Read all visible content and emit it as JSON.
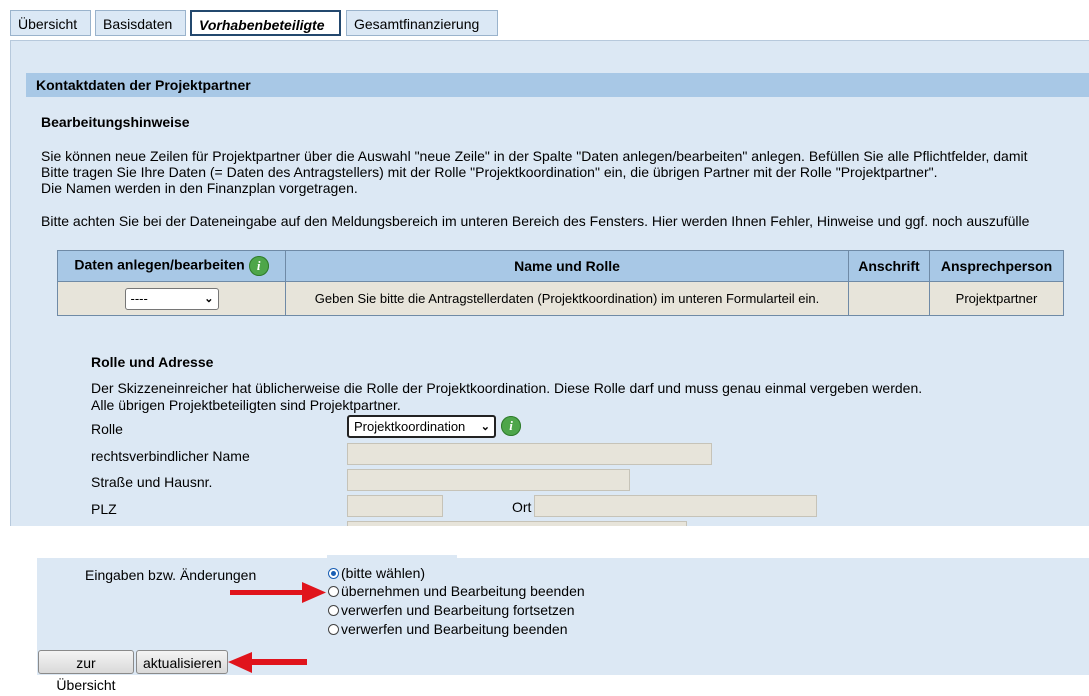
{
  "tabs": [
    {
      "label": "Übersicht",
      "active": false
    },
    {
      "label": "Basisdaten",
      "active": false
    },
    {
      "label": "Vorhabenbeteiligte",
      "active": true
    },
    {
      "label": "Gesamtfinanzierung",
      "active": false
    }
  ],
  "section": {
    "title": "Kontaktdaten der Projektpartner",
    "hints_heading": "Bearbeitungshinweise",
    "hint_lines": [
      "Sie können neue Zeilen für Projektpartner über die Auswahl \"neue Zeile\" in der Spalte \"Daten anlegen/bearbeiten\" anlegen. Befüllen Sie alle Pflichtfelder, damit",
      "Bitte tragen Sie Ihre Daten (= Daten des Antragstellers) mit der Rolle \"Projektkoordination\" ein, die übrigen Partner mit der Rolle \"Projektpartner\".",
      "Die Namen werden in den Finanzplan vorgetragen."
    ],
    "notice_line": "Bitte achten Sie bei der Dateneingabe auf den Meldungsbereich im unteren Bereich des Fensters. Hier werden Ihnen Fehler, Hinweise und ggf. noch auszufülle"
  },
  "table": {
    "headers": [
      "Daten anlegen/bearbeiten",
      "Name und Rolle",
      "Anschrift",
      "Ansprechperson"
    ],
    "row": {
      "action_select": "----",
      "name_role": "Geben Sie bitte die Antragstellerdaten (Projektkoordination) im unteren Formularteil ein.",
      "address": "",
      "contact": "Projektpartner"
    }
  },
  "form": {
    "heading": "Rolle und Adresse",
    "desc_lines": [
      "Der Skizzeneinreicher hat üblicherweise die Rolle der Projektkoordination. Diese Rolle darf und muss genau einmal vergeben werden.",
      "Alle übrigen Projektbeteiligten sind Projektpartner."
    ],
    "labels": {
      "role": "Rolle",
      "legal_name": "rechtsverbindlicher Name",
      "street": "Straße und Hausnr.",
      "zip": "PLZ",
      "city": "Ort"
    },
    "role_value": "Projektkoordination",
    "values": {
      "legal_name": "",
      "street": "",
      "zip": "",
      "city": ""
    }
  },
  "changes": {
    "label": "Eingaben bzw. Änderungen",
    "options": [
      {
        "label": "(bitte wählen)",
        "selected": true
      },
      {
        "label": "übernehmen und Bearbeitung beenden",
        "selected": false
      },
      {
        "label": "verwerfen und Bearbeitung fortsetzen",
        "selected": false
      },
      {
        "label": "verwerfen und Bearbeitung beenden",
        "selected": false
      }
    ]
  },
  "buttons": {
    "overview": "zur Übersicht",
    "refresh": "aktualisieren"
  },
  "colors": {
    "header_bg": "#a8c8e6",
    "panel_bg": "#dce8f4",
    "field_bg": "#e7e4da",
    "arrow": "#e0141c",
    "info": "#4ea64a"
  },
  "icons": [
    "info-icon",
    "chevron-down-icon",
    "arrow-right-icon",
    "arrow-left-icon"
  ]
}
